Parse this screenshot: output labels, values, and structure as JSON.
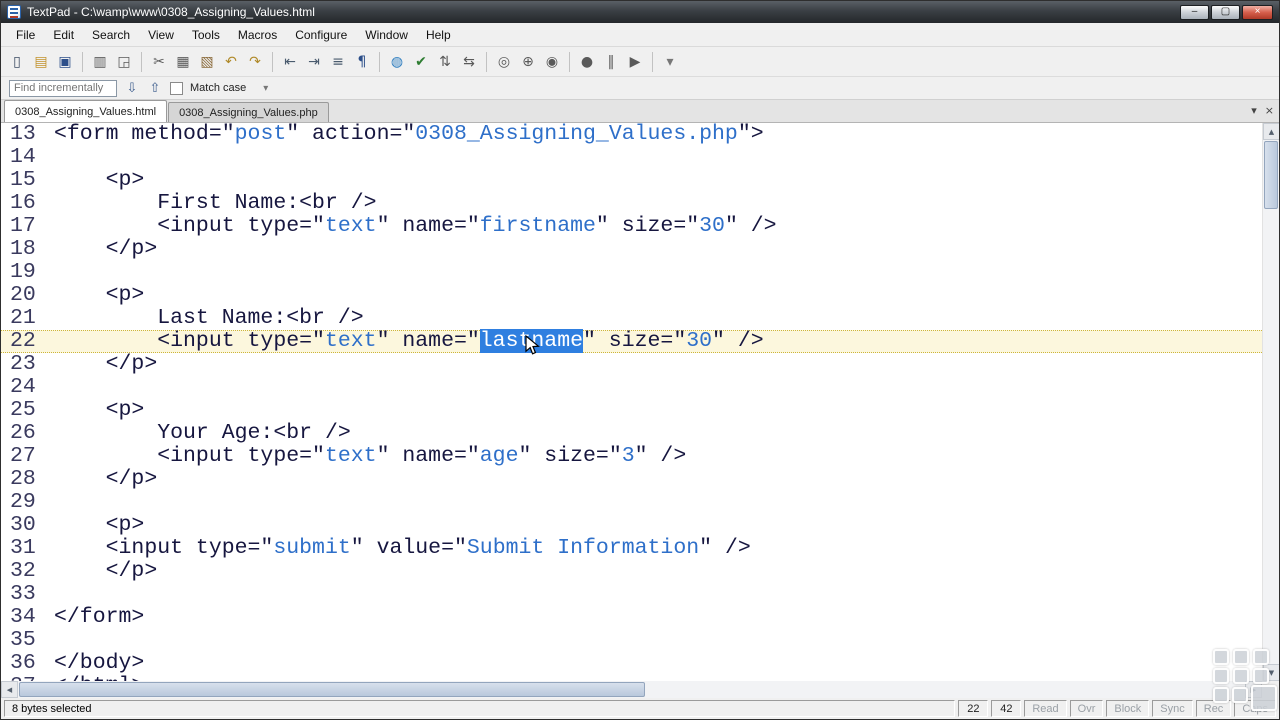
{
  "window": {
    "title": "TextPad - C:\\wamp\\www\\0308_Assigning_Values.html",
    "buttons": [
      {
        "name": "minimize",
        "glyph": "–"
      },
      {
        "name": "maximize",
        "glyph": "▢"
      },
      {
        "name": "close",
        "glyph": "×"
      }
    ]
  },
  "menu": {
    "items": [
      "File",
      "Edit",
      "Search",
      "View",
      "Tools",
      "Macros",
      "Configure",
      "Window",
      "Help"
    ]
  },
  "toolbar": {
    "buttons": [
      {
        "name": "new-file",
        "glyph": "▯",
        "color": "#3c4c63"
      },
      {
        "name": "open-file",
        "glyph": "▤",
        "color": "#c2932f"
      },
      {
        "name": "save-file",
        "glyph": "▣",
        "color": "#2d4f8a"
      },
      {
        "sep": true
      },
      {
        "name": "print",
        "glyph": "▥",
        "color": "#5a5a5a"
      },
      {
        "name": "print-preview",
        "glyph": "◲",
        "color": "#5a5a5a"
      },
      {
        "sep": true
      },
      {
        "name": "cut",
        "glyph": "✂",
        "color": "#5a5a5a"
      },
      {
        "name": "copy",
        "glyph": "▦",
        "color": "#5a5a5a"
      },
      {
        "name": "paste",
        "glyph": "▧",
        "color": "#8a6a3a"
      },
      {
        "name": "undo",
        "glyph": "↶",
        "color": "#b08a2a"
      },
      {
        "name": "redo",
        "glyph": "↷",
        "color": "#b08a2a"
      },
      {
        "sep": true
      },
      {
        "name": "unindent",
        "glyph": "⇤",
        "color": "#4a5b6e"
      },
      {
        "name": "indent",
        "glyph": "⇥",
        "color": "#4a5b6e"
      },
      {
        "name": "reformat",
        "glyph": "≡",
        "color": "#4a5b6e"
      },
      {
        "name": "paragraph-marks",
        "glyph": "¶",
        "color": "#2d4f8a"
      },
      {
        "sep": true
      },
      {
        "name": "html-preview",
        "glyph": "◍",
        "color": "#2e7dbf"
      },
      {
        "name": "spell-check",
        "glyph": "✔",
        "color": "#2e7d32"
      },
      {
        "name": "sort",
        "glyph": "⇅",
        "color": "#5a5a5a"
      },
      {
        "name": "compare-files",
        "glyph": "⇆",
        "color": "#5a5a5a"
      },
      {
        "sep": true
      },
      {
        "name": "view-in-browser",
        "glyph": "◎",
        "color": "#5a5a5a"
      },
      {
        "name": "find",
        "glyph": "⊕",
        "color": "#5a5a5a"
      },
      {
        "name": "find-in-files",
        "glyph": "◉",
        "color": "#5a5a5a"
      },
      {
        "sep": true
      },
      {
        "name": "record-macro",
        "glyph": "●",
        "color": "#5a5a5a"
      },
      {
        "name": "pause-macro",
        "glyph": "‖",
        "color": "#5a5a5a"
      },
      {
        "name": "play-macro",
        "glyph": "▶",
        "color": "#5a5a5a"
      },
      {
        "sep": true
      },
      {
        "name": "toolbar-overflow",
        "glyph": "▾",
        "color": "#777777"
      }
    ]
  },
  "findbar": {
    "placeholder": "Find incrementally",
    "match_case_label": "Match case"
  },
  "tabs": [
    {
      "label": "0308_Assigning_Values.html",
      "active": true
    },
    {
      "label": "0308_Assigning_Values.php",
      "active": false
    }
  ],
  "icons": {
    "scroll_up": "▲",
    "scroll_down": "▼",
    "scroll_left": "◀",
    "scroll_right": "▶",
    "find_down": "⇩",
    "find_up": "⇧",
    "tab_list_chevron": "▾",
    "tab_close": "×",
    "findbar_overflow": "▾"
  },
  "colors": {
    "code_text": "#16163f",
    "string_text": "#2e6fc9",
    "selection_bg": "#2f7fe0",
    "current_line_bg": "#fcf7dd",
    "current_line_border": "#cdb53a",
    "titlebar_bg": "#3a3f44",
    "close_button": "#b03a28"
  },
  "editor": {
    "lines": [
      {
        "n": 13,
        "t": [
          [
            "c",
            "<form method=\""
          ],
          [
            "s",
            "post"
          ],
          [
            "c",
            "\" action=\""
          ],
          [
            "s",
            "0308_Assigning_Values.php"
          ],
          [
            "c",
            "\">"
          ]
        ]
      },
      {
        "n": 14,
        "t": []
      },
      {
        "n": 15,
        "t": [
          [
            "c",
            "    <p>"
          ]
        ]
      },
      {
        "n": 16,
        "t": [
          [
            "c",
            "        First Name:<br />"
          ]
        ]
      },
      {
        "n": 17,
        "t": [
          [
            "c",
            "        <input type=\""
          ],
          [
            "s",
            "text"
          ],
          [
            "c",
            "\" name=\""
          ],
          [
            "s",
            "firstname"
          ],
          [
            "c",
            "\" size=\""
          ],
          [
            "s",
            "30"
          ],
          [
            "c",
            "\" />"
          ]
        ]
      },
      {
        "n": 18,
        "t": [
          [
            "c",
            "    </p>"
          ]
        ]
      },
      {
        "n": 19,
        "t": []
      },
      {
        "n": 20,
        "t": [
          [
            "c",
            "    <p>"
          ]
        ]
      },
      {
        "n": 21,
        "t": [
          [
            "c",
            "        Last Name:<br />"
          ]
        ]
      },
      {
        "n": 22,
        "current": true,
        "t": [
          [
            "c",
            "        <input type=\""
          ],
          [
            "s",
            "text"
          ],
          [
            "c",
            "\" name=\""
          ],
          [
            "sel",
            "lastname"
          ],
          [
            "c",
            "\" size=\""
          ],
          [
            "s",
            "30"
          ],
          [
            "c",
            "\" />"
          ]
        ]
      },
      {
        "n": 23,
        "t": [
          [
            "c",
            "    </p>"
          ]
        ]
      },
      {
        "n": 24,
        "t": []
      },
      {
        "n": 25,
        "t": [
          [
            "c",
            "    <p>"
          ]
        ]
      },
      {
        "n": 26,
        "t": [
          [
            "c",
            "        Your Age:<br />"
          ]
        ]
      },
      {
        "n": 27,
        "t": [
          [
            "c",
            "        <input type=\""
          ],
          [
            "s",
            "text"
          ],
          [
            "c",
            "\" name=\""
          ],
          [
            "s",
            "age"
          ],
          [
            "c",
            "\" size=\""
          ],
          [
            "s",
            "3"
          ],
          [
            "c",
            "\" />"
          ]
        ]
      },
      {
        "n": 28,
        "t": [
          [
            "c",
            "    </p>"
          ]
        ]
      },
      {
        "n": 29,
        "t": []
      },
      {
        "n": 30,
        "t": [
          [
            "c",
            "    <p>"
          ]
        ]
      },
      {
        "n": 31,
        "t": [
          [
            "c",
            "    <input type=\""
          ],
          [
            "s",
            "submit"
          ],
          [
            "c",
            "\" value=\""
          ],
          [
            "s",
            "Submit Information"
          ],
          [
            "c",
            "\" />"
          ]
        ]
      },
      {
        "n": 32,
        "t": [
          [
            "c",
            "    </p>"
          ]
        ]
      },
      {
        "n": 33,
        "t": []
      },
      {
        "n": 34,
        "t": [
          [
            "c",
            "</form>"
          ]
        ]
      },
      {
        "n": 35,
        "t": []
      },
      {
        "n": 36,
        "t": [
          [
            "c",
            "</body>"
          ]
        ]
      },
      {
        "n": 37,
        "t": [
          [
            "c",
            "</html>"
          ]
        ]
      }
    ]
  },
  "statusbar": {
    "selection_info": "8 bytes selected",
    "line": "22",
    "column": "42",
    "indicators": [
      "Read",
      "Ovr",
      "Block",
      "Sync",
      "Rec",
      "Caps"
    ]
  }
}
